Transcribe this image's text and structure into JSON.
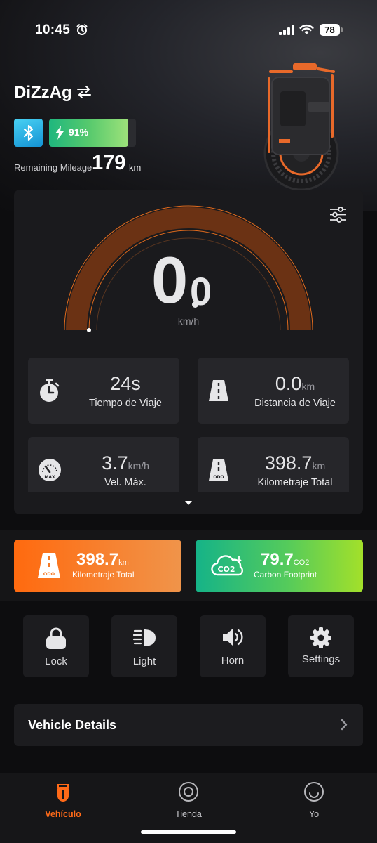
{
  "status_bar": {
    "time": "10:45",
    "battery": "78",
    "icons": [
      "alarm-icon",
      "cellular-signal-icon",
      "wifi-icon",
      "battery-icon"
    ]
  },
  "vehicle": {
    "name": "DiZzAg",
    "battery_percent": "91%",
    "battery_level": 0.91,
    "remaining_mileage_label": "Remaining Mileage",
    "remaining_mileage_value": "179",
    "remaining_mileage_unit": "km"
  },
  "speed": {
    "integer": "0",
    "decimal": "0",
    "unit": "km/h"
  },
  "stats": [
    {
      "value": "24s",
      "unit": "",
      "label": "Tiempo de Viaje",
      "icon": "stopwatch-icon"
    },
    {
      "value": "0.0",
      "unit": "km",
      "label": "Distancia de Viaje",
      "icon": "road-icon"
    },
    {
      "value": "3.7",
      "unit": "km/h",
      "label": "Vel. Máx.",
      "icon": "speedometer-max-icon"
    },
    {
      "value": "398.7",
      "unit": "km",
      "label": "Kilometraje Total",
      "icon": "odometer-road-icon"
    }
  ],
  "summary": {
    "total": {
      "value": "398.7",
      "unit": "km",
      "label": "Kilometraje Total",
      "icon_text": "ODO",
      "color": "#ff6a0f"
    },
    "carbon": {
      "value": "79.7",
      "unit": "CO2",
      "label": "Carbon Footprint",
      "icon_text": "CO2",
      "color": "#55cb5b"
    }
  },
  "controls": [
    {
      "label": "Lock",
      "icon": "lock-icon"
    },
    {
      "label": "Light",
      "icon": "headlight-icon"
    },
    {
      "label": "Horn",
      "icon": "horn-speaker-icon"
    },
    {
      "label": "Settings",
      "icon": "gear-icon"
    }
  ],
  "details": {
    "label": "Vehicle Details"
  },
  "tabs": [
    {
      "label": "Vehículo",
      "icon": "vehicle-icon",
      "active": true
    },
    {
      "label": "Tienda",
      "icon": "store-icon",
      "active": false
    },
    {
      "label": "Yo",
      "icon": "profile-icon",
      "active": false
    }
  ],
  "colors": {
    "accent": "#ff6a18",
    "gauge_arc": "#6b3214",
    "panel": "#1a1a1d",
    "bluetooth": "#1ea7e4"
  }
}
